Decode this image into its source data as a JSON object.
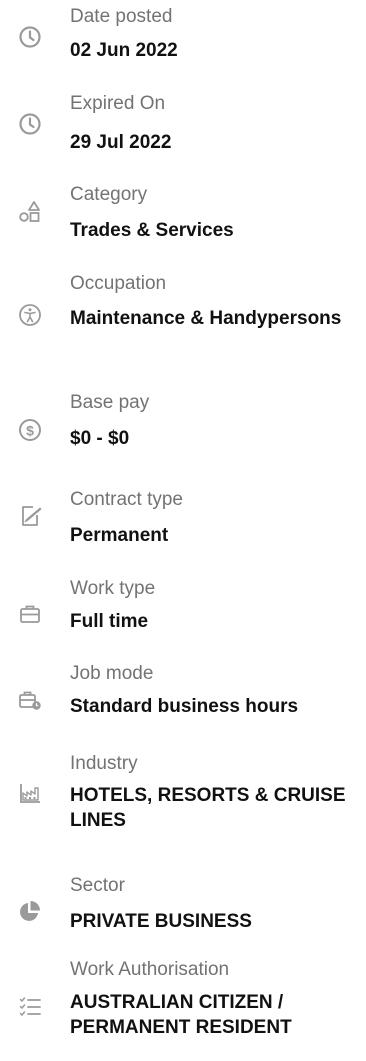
{
  "details": [
    {
      "icon": "clock-icon",
      "label": "Date posted",
      "value": "02 Jun 2022"
    },
    {
      "icon": "clock-icon",
      "label": "Expired On",
      "value": "29 Jul 2022"
    },
    {
      "icon": "shapes-icon",
      "label": "Category",
      "value": "Trades & Services"
    },
    {
      "icon": "accessibility-icon",
      "label": "Occupation",
      "value": "Maintenance & Handypersons"
    },
    {
      "icon": "dollar-icon",
      "label": "Base pay",
      "value": "$0 - $0"
    },
    {
      "icon": "contract-edit-icon",
      "label": "Contract type",
      "value": "Permanent"
    },
    {
      "icon": "briefcase-icon",
      "label": "Work type",
      "value": "Full time"
    },
    {
      "icon": "briefcase-clock-icon",
      "label": "Job mode",
      "value": "Standard business hours"
    },
    {
      "icon": "industry-chart-icon",
      "label": "Industry",
      "value": "HOTELS, RESORTS & CRUISE LINES"
    },
    {
      "icon": "pie-chart-icon",
      "label": "Sector",
      "value": "PRIVATE BUSINESS"
    },
    {
      "icon": "checklist-icon",
      "label": "Work Authorisation",
      "value": "AUSTRALIAN CITIZEN / PERMANENT RESIDENT"
    }
  ],
  "colors": {
    "label": "#737373",
    "value": "#111111",
    "icon": "#9a9a9a"
  }
}
